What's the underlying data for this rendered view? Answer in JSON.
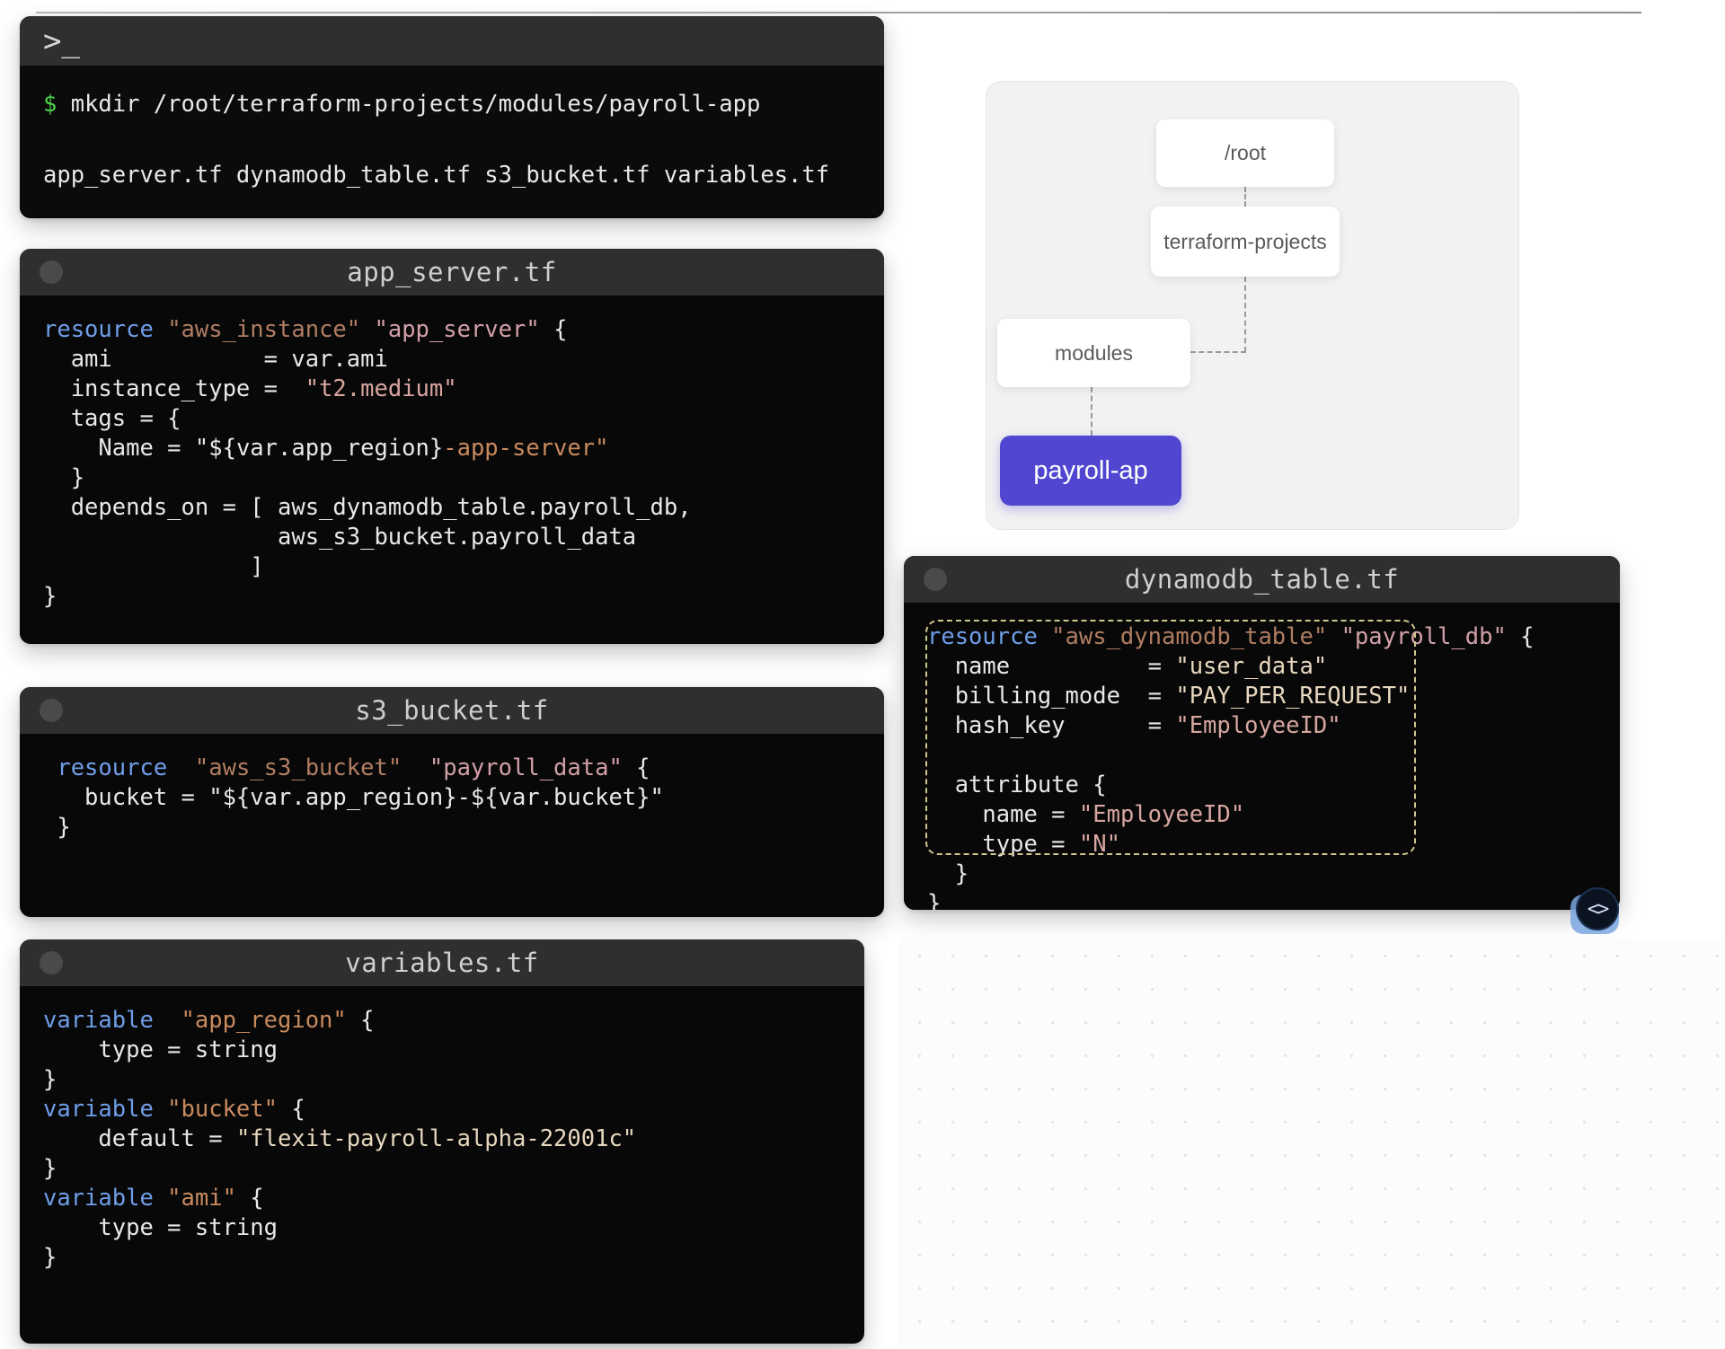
{
  "terminal": {
    "prompt_glyph": ">_",
    "icon": "terminal-prompt-icon",
    "command_prefix": "$",
    "command": "mkdir /root/terraform-projects/modules/payroll-app",
    "output": "app_server.tf dynamodb_table.tf s3_bucket.tf variables.tf"
  },
  "windows": {
    "app_server": {
      "title": "app_server.tf",
      "lines": [
        [
          {
            "t": "resource",
            "c": "kw"
          },
          {
            "t": " ",
            "c": "plain"
          },
          {
            "t": "\"aws_instance\"",
            "c": "res"
          },
          {
            "t": " ",
            "c": "plain"
          },
          {
            "t": "\"app_server\"",
            "c": "name2"
          },
          {
            "t": " {",
            "c": "plain"
          }
        ],
        [
          {
            "t": "  ami           = var.ami",
            "c": "plain"
          }
        ],
        [
          {
            "t": "  instance_type =  ",
            "c": "plain"
          },
          {
            "t": "\"t2.medium\"",
            "c": "str"
          }
        ],
        [
          {
            "t": "  tags = {",
            "c": "plain"
          }
        ],
        [
          {
            "t": "    Name = ",
            "c": "plain"
          },
          {
            "t": "\"${var.app_region}",
            "c": "plain"
          },
          {
            "t": "-app-server\"",
            "c": "orange"
          }
        ],
        [
          {
            "t": "  }",
            "c": "plain"
          }
        ],
        [
          {
            "t": "  depends_on = [ aws_dynamodb_table.payroll_db,",
            "c": "plain"
          }
        ],
        [
          {
            "t": "                 aws_s3_bucket.payroll_data",
            "c": "plain"
          }
        ],
        [
          {
            "t": "               ]",
            "c": "plain"
          }
        ],
        [
          {
            "t": "}",
            "c": "plain"
          }
        ]
      ]
    },
    "s3_bucket": {
      "title": "s3_bucket.tf",
      "lines": [
        [
          {
            "t": " resource ",
            "c": "kw"
          },
          {
            "t": " \"aws_s3_bucket\"",
            "c": "res"
          },
          {
            "t": "  \"payroll_data\"",
            "c": "name2"
          },
          {
            "t": " {",
            "c": "plain"
          }
        ],
        [
          {
            "t": "   bucket = \"${var.app_region}-${var.bucket}\"",
            "c": "plain"
          }
        ],
        [
          {
            "t": " }",
            "c": "plain"
          }
        ]
      ]
    },
    "variables": {
      "title": "variables.tf",
      "lines": [
        [
          {
            "t": "variable ",
            "c": "kw"
          },
          {
            "t": " \"app_region\"",
            "c": "orange"
          },
          {
            "t": " {",
            "c": "plain"
          }
        ],
        [
          {
            "t": "    type = string",
            "c": "plain"
          }
        ],
        [
          {
            "t": "}",
            "c": "plain"
          }
        ],
        [
          {
            "t": "variable ",
            "c": "kw"
          },
          {
            "t": "\"bucket\"",
            "c": "orange"
          },
          {
            "t": " {",
            "c": "plain"
          }
        ],
        [
          {
            "t": "    default = ",
            "c": "plain"
          },
          {
            "t": "\"flexit-payroll-alpha-22001c\"",
            "c": "strpale"
          }
        ],
        [
          {
            "t": "}",
            "c": "plain"
          }
        ],
        [
          {
            "t": "variable ",
            "c": "kw"
          },
          {
            "t": "\"ami\"",
            "c": "orange"
          },
          {
            "t": " {",
            "c": "plain"
          }
        ],
        [
          {
            "t": "    type = string",
            "c": "plain"
          }
        ],
        [
          {
            "t": "}",
            "c": "plain"
          }
        ]
      ]
    },
    "dynamodb_table": {
      "title": "dynamodb_table.tf",
      "lines": [
        [
          {
            "t": "resource ",
            "c": "kw"
          },
          {
            "t": "\"aws_dynamodb_table\"",
            "c": "res"
          },
          {
            "t": " \"payroll_db\"",
            "c": "name2"
          },
          {
            "t": " {",
            "c": "plain"
          }
        ],
        [
          {
            "t": "  name          = ",
            "c": "plain"
          },
          {
            "t": "\"user_data\"",
            "c": "strpale"
          }
        ],
        [
          {
            "t": "  billing_mode  = ",
            "c": "plain"
          },
          {
            "t": "\"PAY_PER_REQUEST\"",
            "c": "strpale"
          }
        ],
        [
          {
            "t": "  hash_key      = ",
            "c": "plain"
          },
          {
            "t": "\"EmployeeID\"",
            "c": "str"
          }
        ],
        [
          {
            "t": "",
            "c": "plain"
          }
        ],
        [
          {
            "t": "  attribute {",
            "c": "plain"
          }
        ],
        [
          {
            "t": "    name = ",
            "c": "plain"
          },
          {
            "t": "\"EmployeeID\"",
            "c": "str"
          }
        ],
        [
          {
            "t": "    type = ",
            "c": "plain"
          },
          {
            "t": "\"N\"",
            "c": "str"
          }
        ],
        [
          {
            "t": "  }",
            "c": "plain"
          }
        ],
        [
          {
            "t": "}",
            "c": "plain"
          }
        ]
      ],
      "code_icon": "code-brackets-icon",
      "code_icon_glyph": "<>"
    }
  },
  "tree": {
    "nodes": [
      {
        "id": "root",
        "label": "/root"
      },
      {
        "id": "terraform-projects",
        "label": "terraform-projects"
      },
      {
        "id": "modules",
        "label": "modules"
      },
      {
        "id": "payroll-app",
        "label": "payroll-ap"
      }
    ],
    "highlight_color": "#5046cf"
  }
}
